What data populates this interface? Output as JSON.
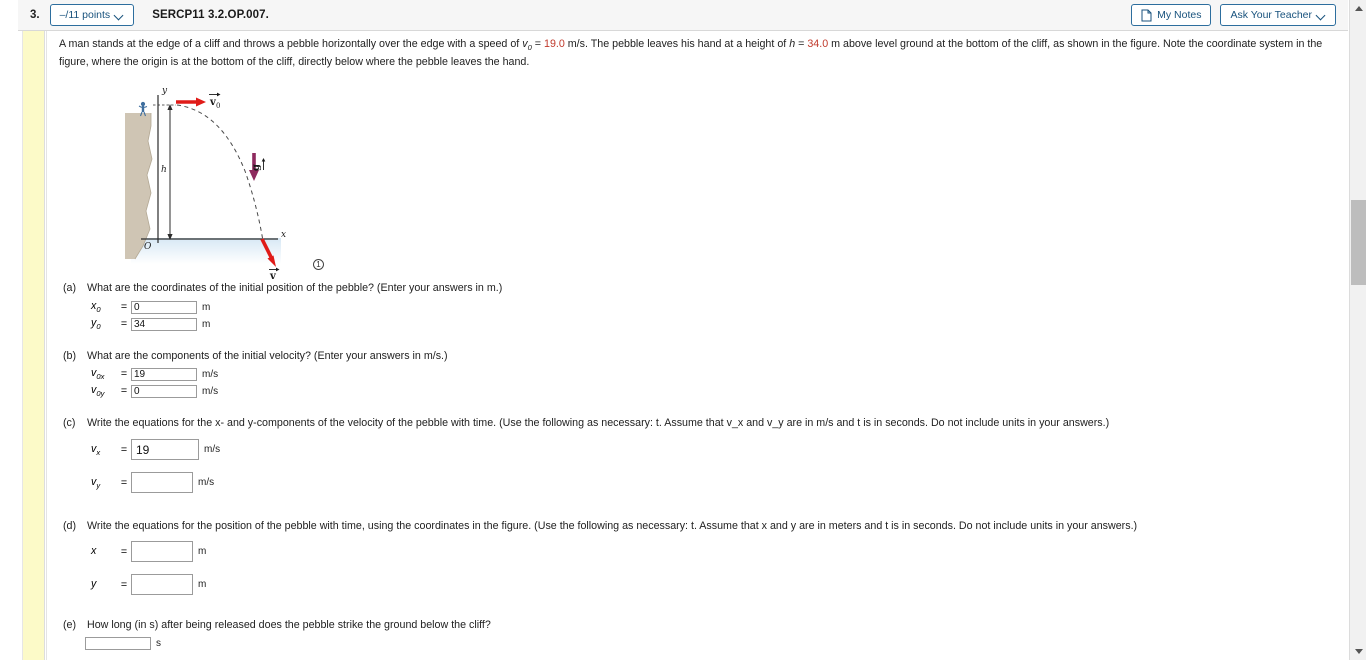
{
  "header": {
    "question_number": "3.",
    "points_label": "–/11 points",
    "question_code": "SERCP11 3.2.OP.007.",
    "my_notes_label": "My Notes",
    "ask_teacher_label": "Ask Your Teacher",
    "note_icon": "note-page-icon",
    "chevron_icon": "chevron-down-icon"
  },
  "problem": {
    "text_part1": "A man stands at the edge of a cliff and throws a pebble horizontally over the edge with a speed of ",
    "v0_symbol": "v",
    "v0_sub": "0",
    "eq1": " = ",
    "v0_value": "19.0",
    "text_part2": " m/s. The pebble leaves his hand at a height of ",
    "h_symbol": "h",
    "eq2": " = ",
    "h_value": "34.0",
    "text_part3": " m above level ground at the bottom of the cliff, as shown in the figure. Note the coordinate system in the figure, where the origin is at the bottom of the cliff, directly below where the pebble leaves the hand."
  },
  "figure": {
    "axis_y_label": "y",
    "axis_x_label": "x",
    "origin_label": "O",
    "height_label": "h",
    "v0_label": "v",
    "v0_sub": "0",
    "g_label": "g",
    "v_label": "v",
    "caption_number": "1",
    "colors": {
      "v0_arrow": "#e01b18",
      "g_arrow": "#8e2a5e",
      "v_arrow": "#e01b18",
      "cliff": "#cfc5b4",
      "water": "#dce9f4"
    }
  },
  "parts": [
    {
      "label": "(a)",
      "question": "What are the coordinates of the initial position of the pebble? (Enter your answers in m.)",
      "fields": [
        {
          "var": "x",
          "sub": "0",
          "value": "0",
          "unit": "m",
          "size": "small"
        },
        {
          "var": "y",
          "sub": "0",
          "value": "34",
          "unit": "m",
          "size": "small"
        }
      ]
    },
    {
      "label": "(b)",
      "question": "What are the components of the initial velocity? (Enter your answers in m/s.)",
      "fields": [
        {
          "var": "v",
          "sub": "0x",
          "value": "19",
          "unit": "m/s",
          "size": "small"
        },
        {
          "var": "v",
          "sub": "0y",
          "value": "0",
          "unit": "m/s",
          "size": "small"
        }
      ]
    },
    {
      "label": "(c)",
      "question": "Write the equations for the x- and y-components of the velocity of the pebble with time. (Use the following as necessary: t. Assume that v_x and v_y are in m/s and t is in seconds. Do not include units in your answers.)",
      "fields": [
        {
          "var": "v",
          "sub": "x",
          "value": "19",
          "unit": "m/s",
          "size": "large"
        },
        {
          "var": "v",
          "sub": "y",
          "value": "",
          "unit": "m/s",
          "size": "large"
        }
      ]
    },
    {
      "label": "(d)",
      "question": "Write the equations for the position of the pebble with time, using the coordinates in the figure. (Use the following as necessary: t. Assume that x and y are in meters and t is in seconds. Do not include units in your answers.)",
      "fields": [
        {
          "var": "x",
          "sub": "",
          "value": "",
          "unit": "m",
          "size": "large"
        },
        {
          "var": "y",
          "sub": "",
          "value": "",
          "unit": "m",
          "size": "large"
        }
      ]
    },
    {
      "label": "(e)",
      "question": "How long (in s) after being released does the pebble strike the ground below the cliff?",
      "fields": [
        {
          "var": "",
          "sub": "",
          "value": "",
          "unit": "s",
          "size": "small"
        }
      ]
    }
  ],
  "scrollbar": {
    "up_icon": "scroll-up-arrow-icon",
    "down_icon": "scroll-down-arrow-icon"
  }
}
